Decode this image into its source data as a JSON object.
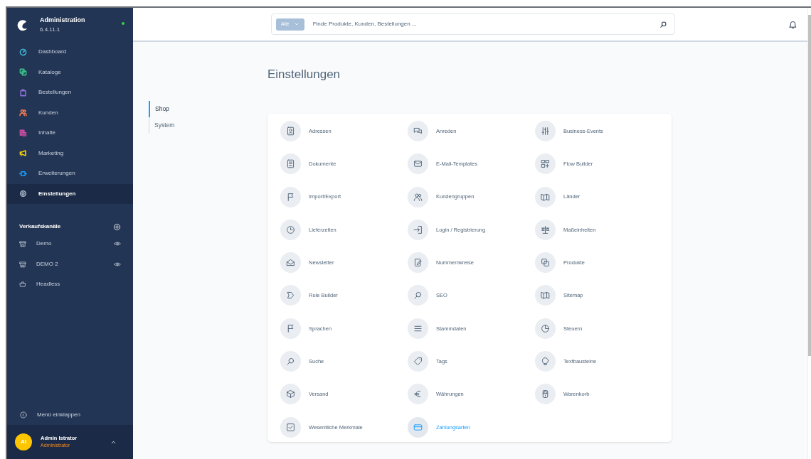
{
  "app": {
    "title": "Administration",
    "version": "6.4.11.1",
    "online": true
  },
  "nav": [
    {
      "label": "Dashboard",
      "color": "#3fb8d6",
      "selected": false
    },
    {
      "label": "Kataloge",
      "color": "#3cc48c",
      "selected": false
    },
    {
      "label": "Bestellungen",
      "color": "#8a70d6",
      "selected": false
    },
    {
      "label": "Kunden",
      "color": "#f27e56",
      "selected": false
    },
    {
      "label": "Inhalte",
      "color": "#d04ea4",
      "selected": false
    },
    {
      "label": "Marketing",
      "color": "#ffd400",
      "selected": false
    },
    {
      "label": "Erweiterungen",
      "color": "#189eff",
      "selected": false
    },
    {
      "label": "Einstellungen",
      "color": "#a9b5c4",
      "selected": true
    }
  ],
  "sales_channels": {
    "title": "Verkaufskanäle",
    "items": [
      {
        "label": "Demo",
        "visibility_toggle": true
      },
      {
        "label": "DEMO 2",
        "visibility_toggle": true
      },
      {
        "label": "Headless",
        "visibility_toggle": false
      }
    ]
  },
  "collapse_label": "Menü einklappen",
  "user": {
    "initials": "AI",
    "name": "Admin Istrator",
    "role": "Administrator"
  },
  "search": {
    "filter": "Alle",
    "placeholder": "Finde Produkte, Kunden, Bestellungen ..."
  },
  "page_title": "Einstellungen",
  "tabs": [
    {
      "label": "Shop",
      "selected": true
    },
    {
      "label": "System",
      "selected": false
    }
  ],
  "settings": [
    {
      "label": "Adressen",
      "selected": false
    },
    {
      "label": "Anreden",
      "selected": false
    },
    {
      "label": "Business-Events",
      "selected": false
    },
    {
      "label": "Dokumente",
      "selected": false
    },
    {
      "label": "E-Mail-Templates",
      "selected": false
    },
    {
      "label": "Flow Builder",
      "selected": false
    },
    {
      "label": "Import/Export",
      "selected": false
    },
    {
      "label": "Kundengruppen",
      "selected": false
    },
    {
      "label": "Länder",
      "selected": false
    },
    {
      "label": "Lieferzeiten",
      "selected": false
    },
    {
      "label": "Login / Registrierung",
      "selected": false
    },
    {
      "label": "Maßeinheiten",
      "selected": false
    },
    {
      "label": "Newsletter",
      "selected": false
    },
    {
      "label": "Nummernkreise",
      "selected": false
    },
    {
      "label": "Produkte",
      "selected": false
    },
    {
      "label": "Rule Builder",
      "selected": false
    },
    {
      "label": "SEO",
      "selected": false
    },
    {
      "label": "Sitemap",
      "selected": false
    },
    {
      "label": "Sprachen",
      "selected": false
    },
    {
      "label": "Stammdaten",
      "selected": false
    },
    {
      "label": "Steuern",
      "selected": false
    },
    {
      "label": "Suche",
      "selected": false
    },
    {
      "label": "Tags",
      "selected": false
    },
    {
      "label": "Textbausteine",
      "selected": false
    },
    {
      "label": "Versand",
      "selected": false
    },
    {
      "label": "Währungen",
      "selected": false
    },
    {
      "label": "Warenkorb",
      "selected": false
    },
    {
      "label": "Wesentliche Merkmale",
      "selected": false
    },
    {
      "label": "Zahlungsarten",
      "selected": true
    }
  ]
}
